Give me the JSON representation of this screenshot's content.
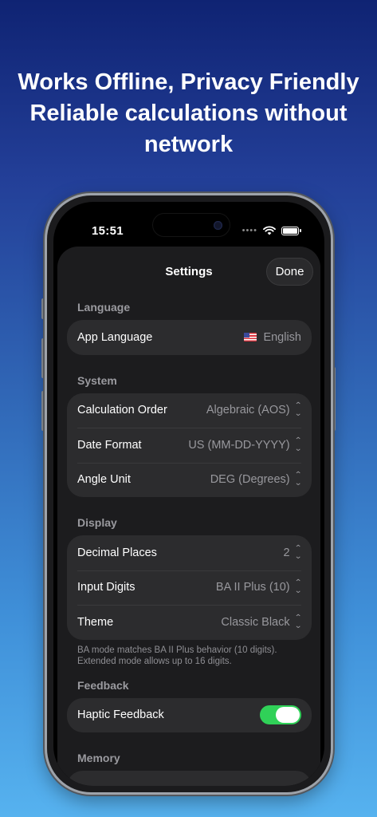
{
  "headline": {
    "line1": "Works Offline, Privacy Friendly",
    "line2": "Reliable calculations without",
    "line3": "network"
  },
  "status_bar": {
    "time": "15:51",
    "signal_icon": "signal-dots-icon",
    "wifi_icon": "wifi-icon",
    "battery_icon": "battery-icon"
  },
  "settings": {
    "title": "Settings",
    "done_label": "Done",
    "language_section": {
      "label": "Language",
      "rows": [
        {
          "label": "App Language",
          "value": "English",
          "icon": "us-flag-icon"
        }
      ]
    },
    "system_section": {
      "label": "System",
      "rows": [
        {
          "label": "Calculation Order",
          "value": "Algebraic (AOS)"
        },
        {
          "label": "Date Format",
          "value": "US (MM-DD-YYYY)"
        },
        {
          "label": "Angle Unit",
          "value": "DEG (Degrees)"
        }
      ]
    },
    "display_section": {
      "label": "Display",
      "rows": [
        {
          "label": "Decimal Places",
          "value": "2"
        },
        {
          "label": "Input Digits",
          "value": "BA II Plus (10)"
        },
        {
          "label": "Theme",
          "value": "Classic Black"
        }
      ],
      "footnote_line1": "BA mode matches BA II Plus behavior (10 digits).",
      "footnote_line2": "Extended mode allows up to 16 digits."
    },
    "feedback_section": {
      "label": "Feedback",
      "rows": [
        {
          "label": "Haptic Feedback",
          "toggle_on": true
        }
      ]
    },
    "memory_section": {
      "label": "Memory"
    }
  },
  "colors": {
    "accent_toggle": "#30d158",
    "sheet_bg": "#1c1c1e",
    "group_bg": "#2c2c2e"
  }
}
